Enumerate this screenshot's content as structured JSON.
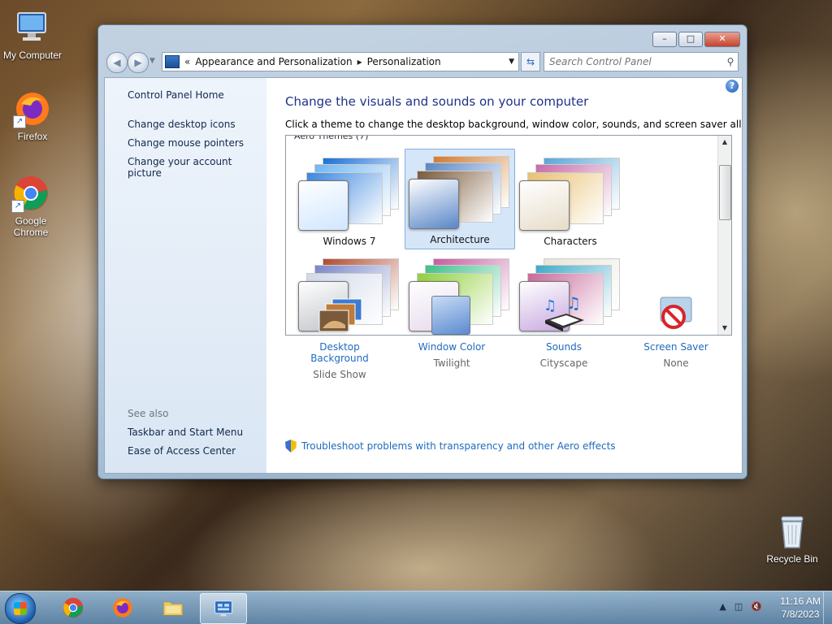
{
  "desktop": {
    "icons": [
      {
        "label": "My Computer"
      },
      {
        "label": "Firefox"
      },
      {
        "label": "Google Chrome"
      },
      {
        "label": "Recycle Bin"
      }
    ]
  },
  "window": {
    "breadcrumb": {
      "prefix": "«",
      "crumbs": [
        "Appearance and Personalization",
        "Personalization"
      ]
    },
    "search": {
      "placeholder": "Search Control Panel"
    }
  },
  "left_pane": {
    "home": "Control Panel Home",
    "links": [
      "Change desktop icons",
      "Change mouse pointers",
      "Change your account picture"
    ],
    "see_also_title": "See also",
    "see_also": [
      "Taskbar and Start Menu",
      "Ease of Access Center"
    ]
  },
  "main": {
    "title": "Change the visuals and sounds on your computer",
    "subtitle": "Click a theme to change the desktop background, window color, sounds, and screen saver all at once.",
    "group_label": "Aero Themes (7)",
    "themes": [
      {
        "name": "Windows 7",
        "selected": false,
        "colors": [
          "#1c6fd6",
          "#6fb5f0",
          "#3a86df"
        ],
        "glass": "#cfe6ff"
      },
      {
        "name": "Architecture",
        "selected": true,
        "colors": [
          "#d07a2b",
          "#5b86c4",
          "#7a5a3a"
        ],
        "glass": "#5a86c8"
      },
      {
        "name": "Characters",
        "selected": false,
        "colors": [
          "#59a6d6",
          "#c86aa8",
          "#e8c070"
        ],
        "glass": "#e7dcc8"
      },
      {
        "name": "",
        "selected": false,
        "colors": [
          "#b14a2e",
          "#7a86c8",
          "#d0d8e8"
        ],
        "glass": "#bfc3c8"
      },
      {
        "name": "",
        "selected": false,
        "colors": [
          "#c85aa0",
          "#3fbf8a",
          "#8fcf3a"
        ],
        "glass": "#e6d8ec"
      },
      {
        "name": "",
        "selected": false,
        "colors": [
          "#e9e4d6",
          "#3fa9c8",
          "#c86a9a"
        ],
        "glass": "#c8a8e0"
      }
    ],
    "bottom_items": [
      {
        "label": "Desktop Background",
        "value": "Slide Show"
      },
      {
        "label": "Window Color",
        "value": "Twilight"
      },
      {
        "label": "Sounds",
        "value": "Cityscape"
      },
      {
        "label": "Screen Saver",
        "value": "None"
      }
    ],
    "troubleshoot_link": "Troubleshoot problems with transparency and other Aero effects"
  },
  "taskbar": {
    "clock_time": "11:16 AM",
    "clock_date": "7/8/2023"
  },
  "colors": {
    "link": "#1f6bbf",
    "title": "#1e3287",
    "selection": "#d5e6f8"
  }
}
